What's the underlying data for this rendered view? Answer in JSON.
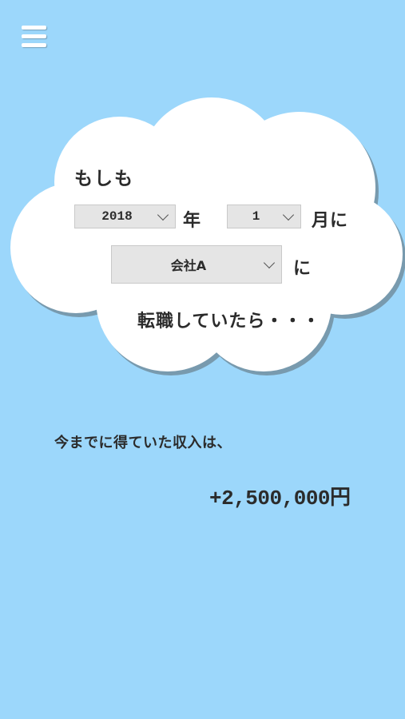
{
  "menu": {
    "icon": "hamburger-menu-icon"
  },
  "colors": {
    "background": "#9cd7fb",
    "cloud": "#ffffff",
    "text": "#2b2b2b",
    "select_bg": "#e5e5e5"
  },
  "question": {
    "intro": "もしも",
    "year": {
      "selected": "2018",
      "unit": "年"
    },
    "month": {
      "selected": "1",
      "unit": "月に"
    },
    "company": {
      "selected": "会社A",
      "suffix": "に"
    },
    "ending": "転職していたら・・・"
  },
  "result": {
    "label": "今までに得ていた収入は、",
    "value": "+2,500,000円"
  }
}
